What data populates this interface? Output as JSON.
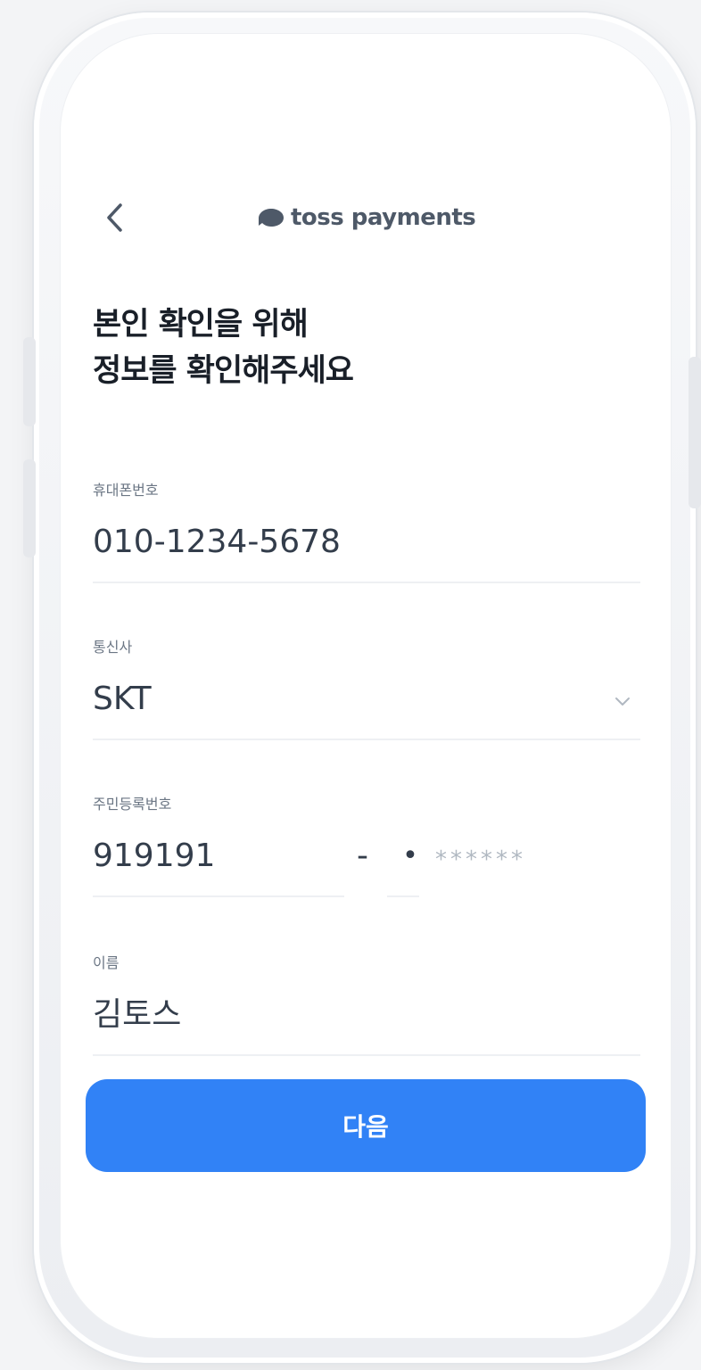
{
  "header": {
    "logo_text": "toss payments"
  },
  "title": {
    "line1": "본인 확인을 위해",
    "line2": "정보를 확인해주세요"
  },
  "fields": {
    "phone": {
      "label": "휴대폰번호",
      "value": "010-1234-5678"
    },
    "carrier": {
      "label": "통신사",
      "value": "SKT"
    },
    "rrn": {
      "label": "주민등록번호",
      "front": "919191",
      "dash": "-",
      "back_first": "•",
      "back_mask": "******"
    },
    "name": {
      "label": "이름",
      "value": "김토스"
    }
  },
  "button": {
    "next_label": "다음"
  },
  "colors": {
    "accent": "#3182f6",
    "text_primary": "#191f28",
    "text_secondary": "#6b7684",
    "placeholder": "#b0b8c1"
  },
  "icons": {
    "back": "chevron-left-icon",
    "logo": "toss-logo-icon",
    "carrier_dropdown": "chevron-down-icon"
  }
}
